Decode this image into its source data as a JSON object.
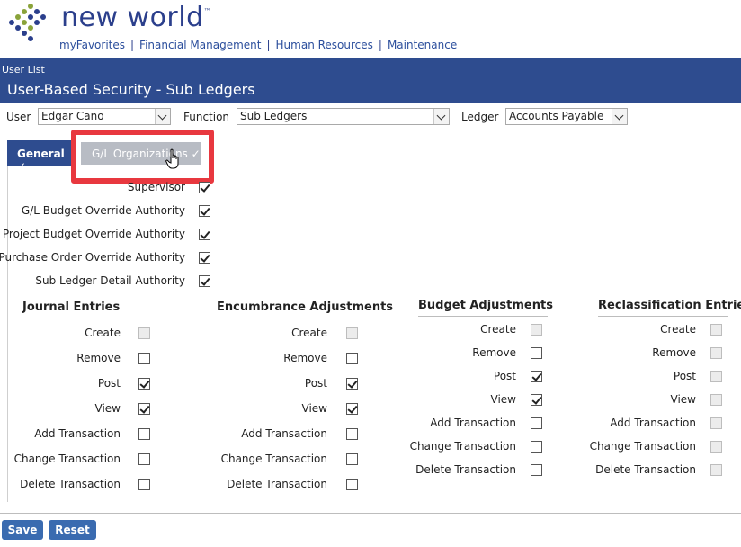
{
  "header": {
    "brand": "new world",
    "trademark": "™",
    "nav": [
      "myFavorites",
      "Financial Management",
      "Human Resources",
      "Maintenance"
    ],
    "nav_sep": "|"
  },
  "titlebar": {
    "breadcrumb": "User List",
    "title": "User-Based Security - Sub Ledgers"
  },
  "filters": {
    "user_label": "User",
    "user_value": "Edgar Cano",
    "function_label": "Function",
    "function_value": "Sub Ledgers",
    "ledger_label": "Ledger",
    "ledger_value": "Accounts Payable"
  },
  "tabs": {
    "general": "General ✓",
    "gl_orgs": "G/L Organizations ✓"
  },
  "authorities": [
    {
      "label": "Supervisor",
      "checked": true
    },
    {
      "label": "G/L Budget Override Authority",
      "checked": true
    },
    {
      "label": "Project Budget Override Authority",
      "checked": true
    },
    {
      "label": "Purchase Order Override Authority",
      "checked": true
    },
    {
      "label": "Sub Ledger Detail Authority",
      "checked": true
    }
  ],
  "sections": {
    "journal": {
      "title": "Journal Entries",
      "items": [
        {
          "label": "Create",
          "state": "disabled"
        },
        {
          "label": "Remove",
          "state": "unchecked"
        },
        {
          "label": "Post",
          "state": "checked"
        },
        {
          "label": "View",
          "state": "checked"
        },
        {
          "label": "Add Transaction",
          "state": "unchecked"
        },
        {
          "label": "Change Transaction",
          "state": "unchecked"
        },
        {
          "label": "Delete Transaction",
          "state": "unchecked"
        }
      ]
    },
    "encumbrance": {
      "title": "Encumbrance Adjustments",
      "items": [
        {
          "label": "Create",
          "state": "disabled"
        },
        {
          "label": "Remove",
          "state": "unchecked"
        },
        {
          "label": "Post",
          "state": "checked"
        },
        {
          "label": "View",
          "state": "checked"
        },
        {
          "label": "Add Transaction",
          "state": "unchecked"
        },
        {
          "label": "Change Transaction",
          "state": "unchecked"
        },
        {
          "label": "Delete Transaction",
          "state": "unchecked"
        }
      ]
    },
    "budget": {
      "title": "Budget Adjustments",
      "items": [
        {
          "label": "Create",
          "state": "disabled"
        },
        {
          "label": "Remove",
          "state": "unchecked"
        },
        {
          "label": "Post",
          "state": "checked"
        },
        {
          "label": "View",
          "state": "checked"
        },
        {
          "label": "Add Transaction",
          "state": "unchecked"
        },
        {
          "label": "Change Transaction",
          "state": "unchecked"
        },
        {
          "label": "Delete Transaction",
          "state": "unchecked"
        }
      ]
    },
    "reclass": {
      "title": "Reclassification Entries",
      "items": [
        {
          "label": "Create",
          "state": "disabled"
        },
        {
          "label": "Remove",
          "state": "disabled"
        },
        {
          "label": "Post",
          "state": "disabled"
        },
        {
          "label": "View",
          "state": "disabled"
        },
        {
          "label": "Add Transaction",
          "state": "disabled"
        },
        {
          "label": "Change Transaction",
          "state": "disabled"
        },
        {
          "label": "Delete Transaction",
          "state": "disabled"
        }
      ]
    }
  },
  "buttons": {
    "save": "Save",
    "reset": "Reset"
  },
  "colors": {
    "brand_blue": "#2e4c8f",
    "highlight_red": "#e8383f",
    "button_blue": "#3a6bb0"
  }
}
